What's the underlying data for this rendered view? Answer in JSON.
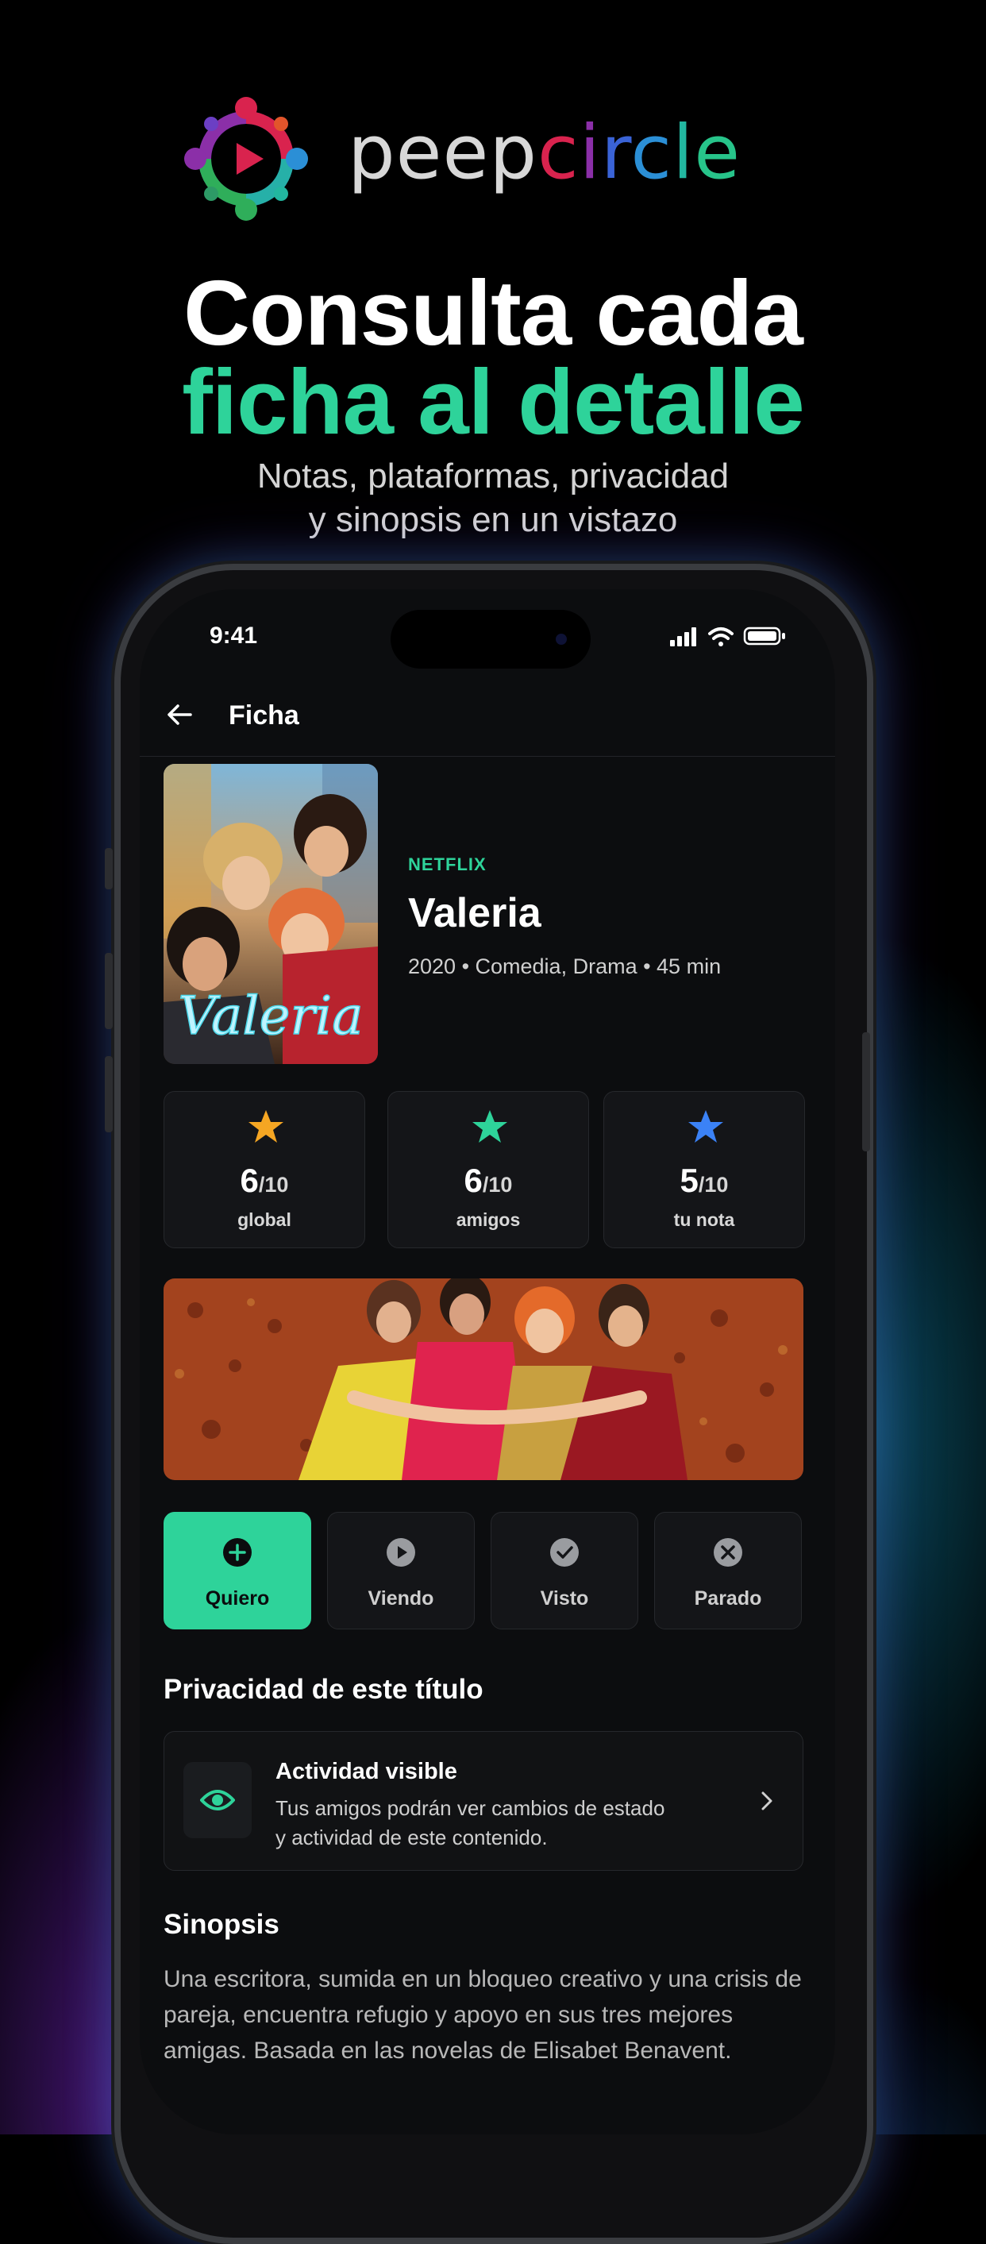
{
  "brand": {
    "wordmark_part1": "peep",
    "wordmark_part2": [
      "c",
      "i",
      "r",
      "c",
      "l",
      "e"
    ],
    "logo_icon": "play-circle-people-icon"
  },
  "marketing": {
    "headline_line1": "Consulta cada",
    "headline_line2": "ficha al detalle",
    "subtitle_line1": "Notas, plataformas, privacidad",
    "subtitle_line2": "y sinopsis en un vistazo",
    "accent_color": "#2ed39a"
  },
  "status_bar": {
    "time": "9:41",
    "icons": [
      "signal-icon",
      "wifi-icon",
      "battery-icon"
    ]
  },
  "navbar": {
    "back_icon": "arrow-left-icon",
    "title": "Ficha"
  },
  "detail": {
    "platform": "NETFLIX",
    "title": "Valeria",
    "meta": "2020 • Comedia, Drama • 45 min",
    "poster_text": "Valeria"
  },
  "ratings": [
    {
      "score": "6",
      "scale": "/10",
      "label": "global",
      "color": "#f5a623"
    },
    {
      "score": "6",
      "scale": "/10",
      "label": "amigos",
      "color": "#2ed39a"
    },
    {
      "score": "5",
      "scale": "/10",
      "label": "tu nota",
      "color": "#3b82f6"
    }
  ],
  "states": [
    {
      "label": "Quiero",
      "icon": "plus-circle-icon",
      "active": true
    },
    {
      "label": "Viendo",
      "icon": "play-circle-icon",
      "active": false
    },
    {
      "label": "Visto",
      "icon": "check-circle-icon",
      "active": false
    },
    {
      "label": "Parado",
      "icon": "x-circle-icon",
      "active": false
    }
  ],
  "privacy": {
    "section_title": "Privacidad de este título",
    "heading": "Actividad visible",
    "text_line1": "Tus amigos podrán ver cambios de estado",
    "text_line2": "y actividad de este contenido.",
    "icon": "eye-icon"
  },
  "synopsis": {
    "section_title": "Sinopsis",
    "text": "Una escritora, sumida en un bloqueo creativo y una crisis de pareja, encuentra refugio y apoyo en sus tres mejores amigas. Basada en las novelas de Elisabet Benavent."
  }
}
